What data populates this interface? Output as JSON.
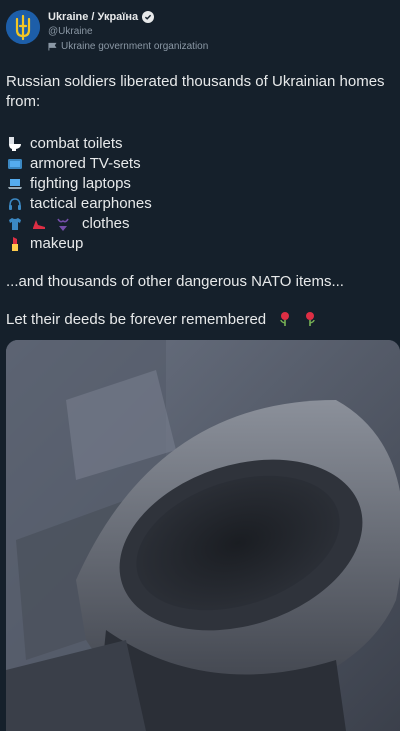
{
  "account": {
    "name": "Ukraine / Україна",
    "handle": "@Ukraine",
    "label": "Ukraine government organization"
  },
  "tweet": {
    "intro": "Russian soldiers liberated thousands of Ukrainian homes from:",
    "items": [
      {
        "emoji": "toilet-icon",
        "text": "combat toilets"
      },
      {
        "emoji": "tv-icon",
        "text": "armored TV-sets"
      },
      {
        "emoji": "laptop-icon",
        "text": "fighting laptops"
      },
      {
        "emoji": "earphones-icon",
        "text": "tactical earphones"
      },
      {
        "emoji": "clothes-icon",
        "text": "clothes"
      },
      {
        "emoji": "lipstick-icon",
        "text": "makeup"
      }
    ],
    "outro": "...and thousands of other dangerous NATO items...",
    "closing": "Let their deeds be forever remembered"
  },
  "colors": {
    "background": "#15202b",
    "text": "#e7e9ea",
    "secondary": "#8b98a5",
    "verified": "#1d9bf0"
  }
}
